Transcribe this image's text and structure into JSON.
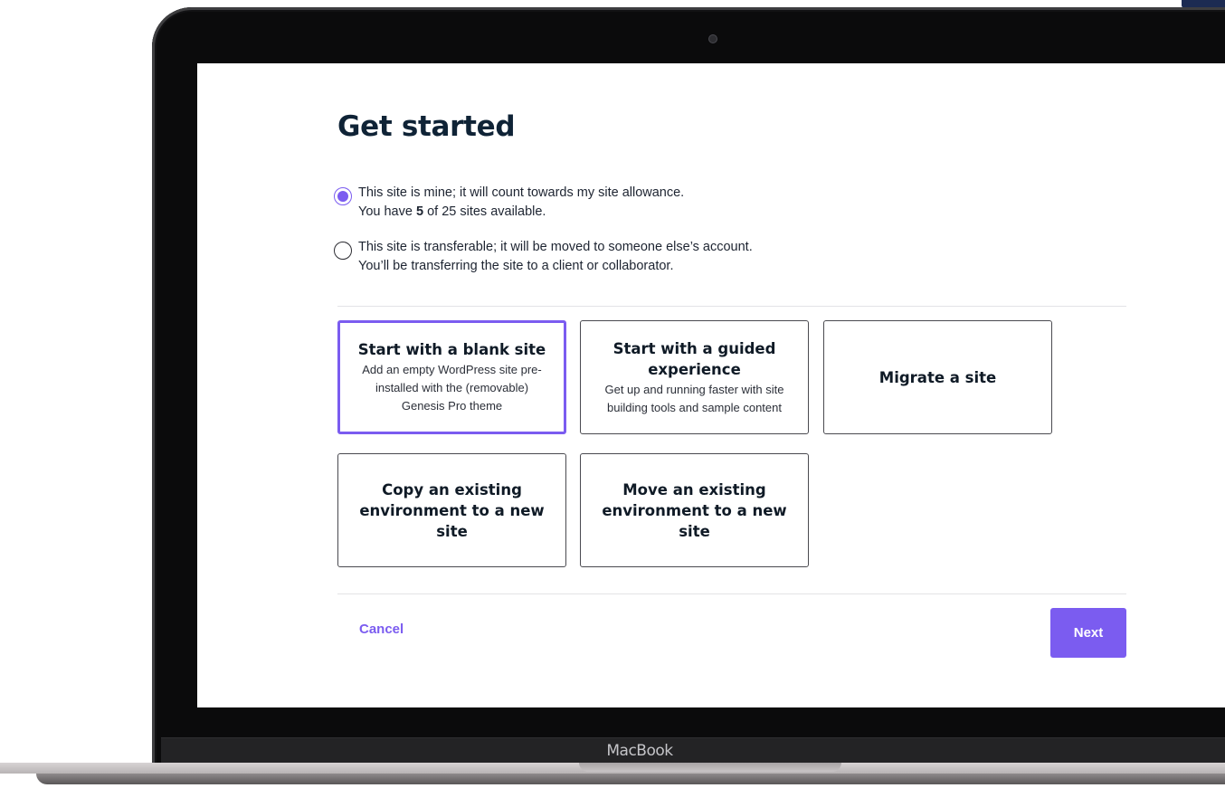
{
  "page": {
    "title": "Get started",
    "accent_color": "#7b5cf0"
  },
  "ownership": {
    "options": [
      {
        "line1": "This site is mine; it will count towards my site allowance.",
        "line2_prefix": "You have ",
        "line2_count": "5",
        "line2_suffix": " of 25 sites available.",
        "selected": true
      },
      {
        "line1": "This site is transferable; it will be moved to someone else’s account.",
        "line2": "You’ll be transferring the site to a client or collaborator.",
        "selected": false
      }
    ]
  },
  "options": [
    {
      "title": "Start with a blank site",
      "description": "Add an empty WordPress site pre-installed with the (removable) Genesis Pro theme",
      "selected": true
    },
    {
      "title": "Start with a guided experience",
      "description": "Get up and running faster with site building tools and sample content",
      "selected": false
    },
    {
      "title": "Migrate a site",
      "selected": false
    },
    {
      "title": "Copy an existing environment to a new site",
      "selected": false
    },
    {
      "title": "Move an existing environment to a new site",
      "selected": false
    }
  ],
  "footer": {
    "cancel_label": "Cancel",
    "next_label": "Next"
  },
  "device": {
    "brand_label": "MacBook"
  }
}
